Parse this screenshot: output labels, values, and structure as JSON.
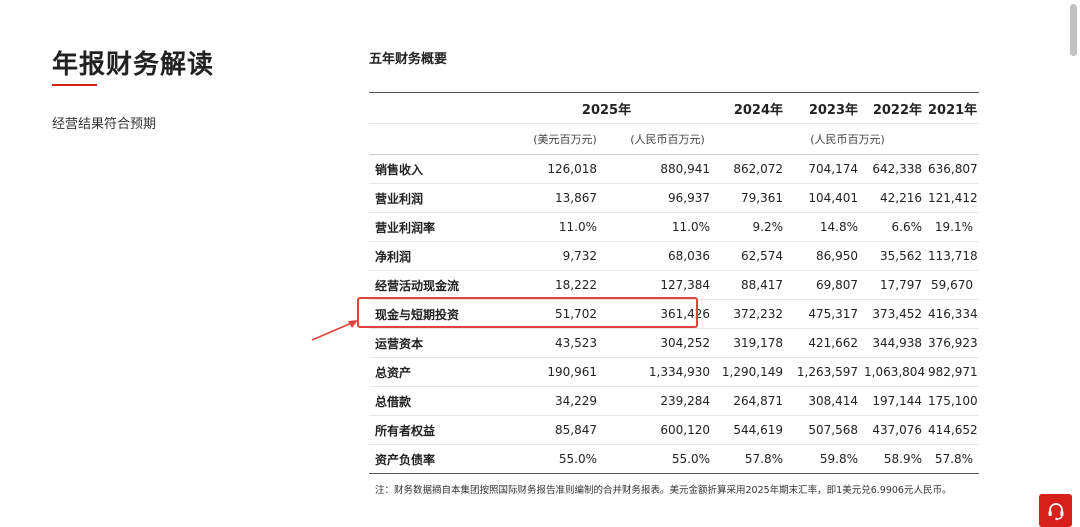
{
  "left": {
    "title": "年报财务解读",
    "subtitle": "经营结果符合预期"
  },
  "section_title": "五年财务概要",
  "table": {
    "years": [
      "2025年",
      "2024年",
      "2023年",
      "2022年",
      "2021年"
    ],
    "units": [
      "(美元百万元)",
      "(人民币百万元)",
      "(人民币百万元)"
    ],
    "rows": [
      {
        "label": "销售收入",
        "values": [
          "126,018",
          "880,941",
          "862,072",
          "704,174",
          "642,338",
          "636,807"
        ]
      },
      {
        "label": "营业利润",
        "values": [
          "13,867",
          "96,937",
          "79,361",
          "104,401",
          "42,216",
          "121,412"
        ]
      },
      {
        "label": "营业利润率",
        "values": [
          "11.0%",
          "11.0%",
          "9.2%",
          "14.8%",
          "6.6%",
          "19.1%"
        ]
      },
      {
        "label": "净利润",
        "values": [
          "9,732",
          "68,036",
          "62,574",
          "86,950",
          "35,562",
          "113,718"
        ]
      },
      {
        "label": "经营活动现金流",
        "values": [
          "18,222",
          "127,384",
          "88,417",
          "69,807",
          "17,797",
          "59,670"
        ]
      },
      {
        "label": "现金与短期投资",
        "values": [
          "51,702",
          "361,426",
          "372,232",
          "475,317",
          "373,452",
          "416,334"
        ]
      },
      {
        "label": "运营资本",
        "values": [
          "43,523",
          "304,252",
          "319,178",
          "421,662",
          "344,938",
          "376,923"
        ]
      },
      {
        "label": "总资产",
        "values": [
          "190,961",
          "1,334,930",
          "1,290,149",
          "1,263,597",
          "1,063,804",
          "982,971"
        ]
      },
      {
        "label": "总借款",
        "values": [
          "34,229",
          "239,284",
          "264,871",
          "308,414",
          "197,144",
          "175,100"
        ]
      },
      {
        "label": "所有者权益",
        "values": [
          "85,847",
          "600,120",
          "544,619",
          "507,568",
          "437,076",
          "414,652"
        ]
      },
      {
        "label": "资产负债率",
        "values": [
          "55.0%",
          "55.0%",
          "57.8%",
          "59.8%",
          "58.9%",
          "57.8%"
        ]
      }
    ]
  },
  "note": "注：财务数据摘自本集团按照国际财务报告准则编制的合并财务报表。美元金额折算采用2025年期末汇率，即1美元兑6.9906元人民币。",
  "colors": {
    "accent": "#d7201a",
    "highlight": "#e0443c"
  },
  "icons": {
    "support": "customer-service-headset-icon",
    "annotation": "arrow-icon"
  }
}
